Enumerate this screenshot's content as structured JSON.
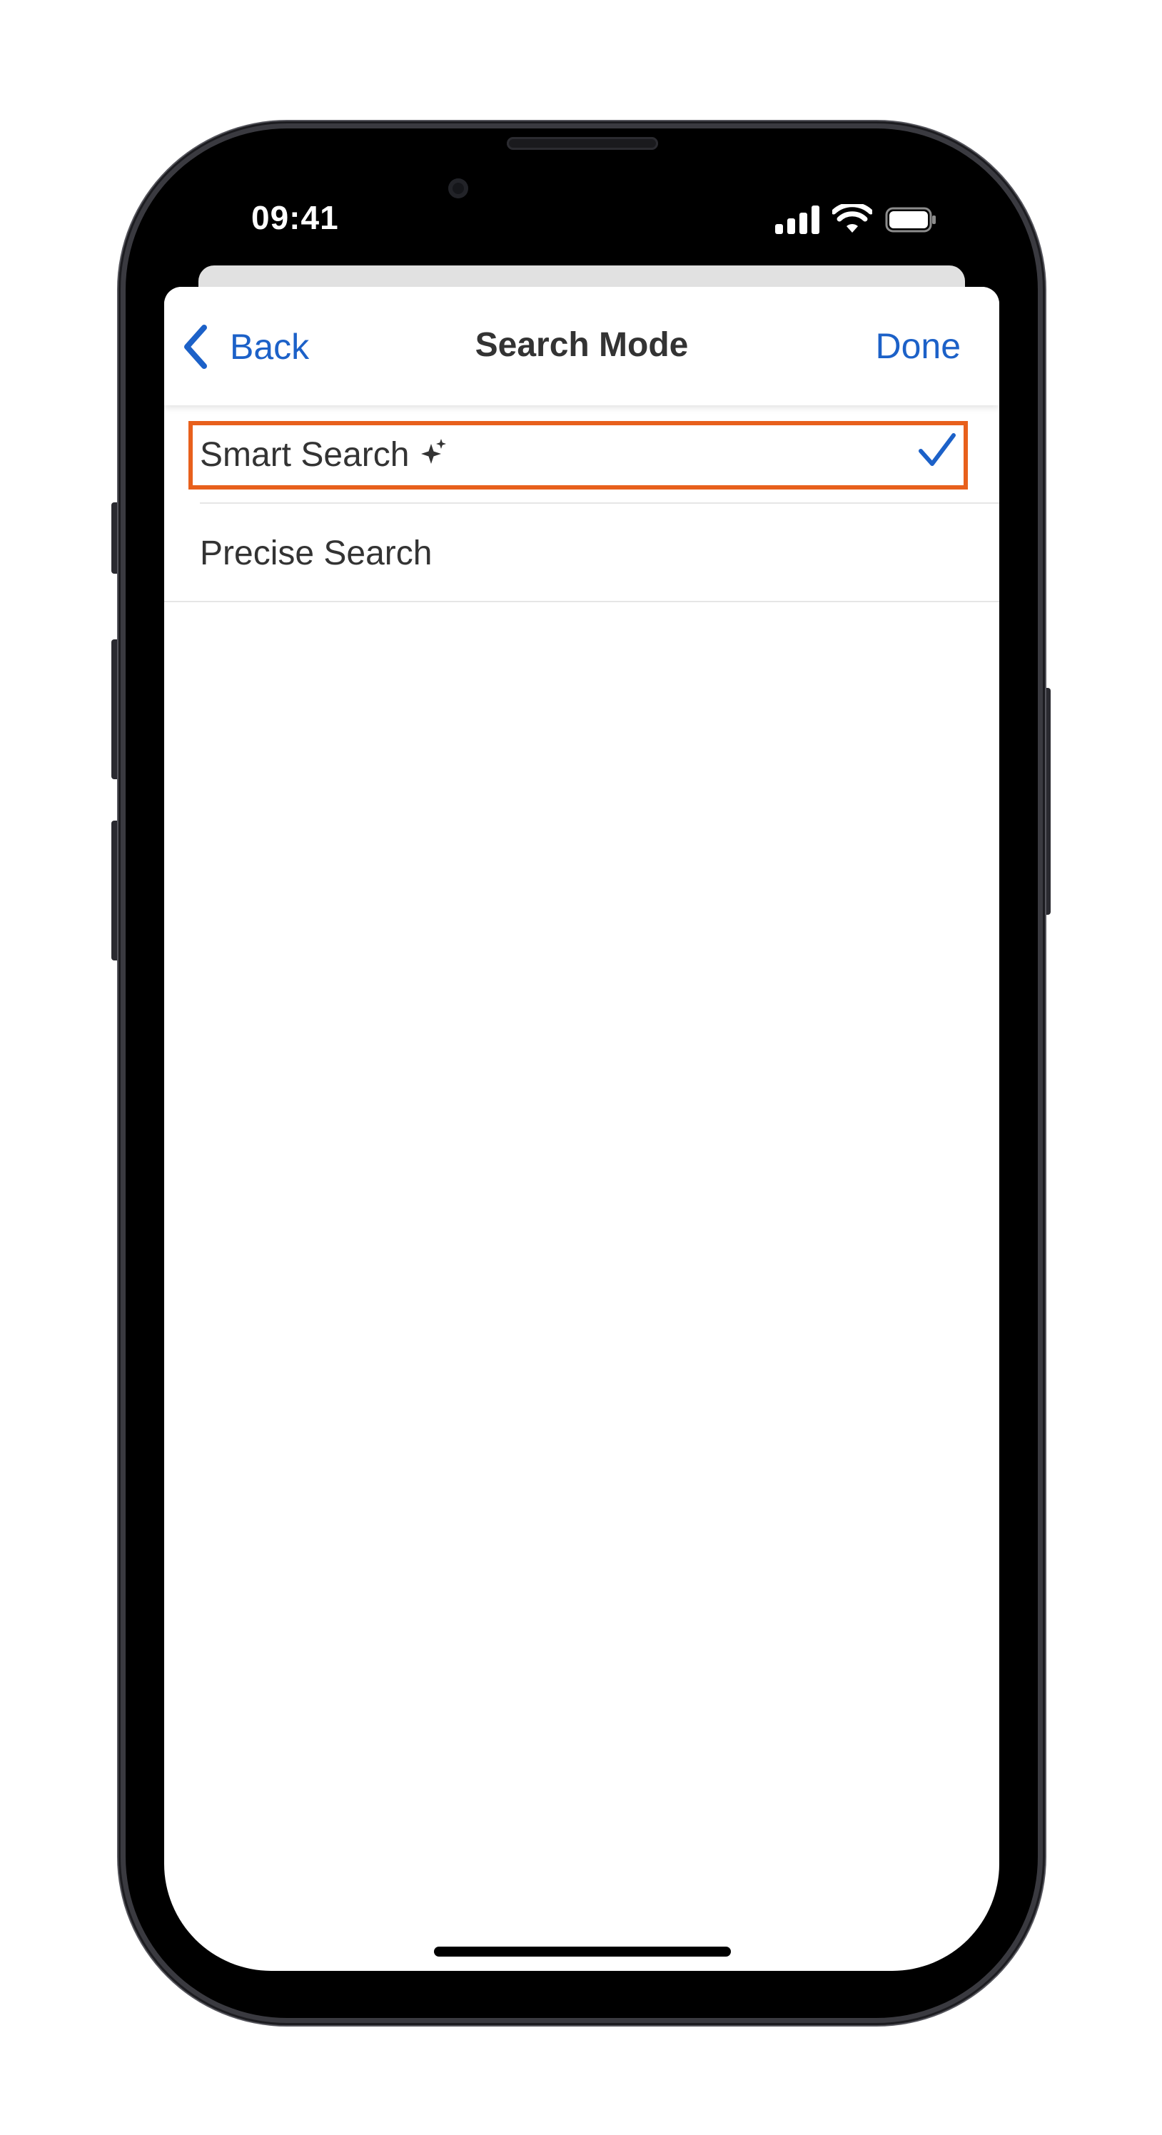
{
  "status_bar": {
    "time": "09:41",
    "signal_icon": "cellular-signal-icon",
    "wifi_icon": "wifi-icon",
    "battery_icon": "battery-icon"
  },
  "navbar": {
    "back_label": "Back",
    "back_icon": "chevron-left-icon",
    "title": "Search Mode",
    "done_label": "Done"
  },
  "options": [
    {
      "label": "Smart Search",
      "icon": "sparkle-icon",
      "selected": true
    },
    {
      "label": "Precise Search",
      "selected": false
    }
  ],
  "colors": {
    "accent": "#1c61c8",
    "highlight": "#e8601c",
    "text": "#333333"
  }
}
